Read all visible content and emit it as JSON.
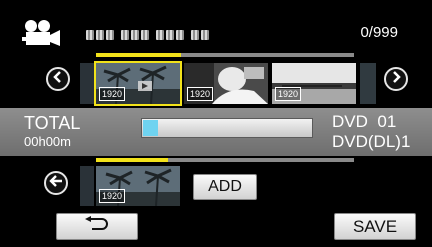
{
  "header": {
    "counter": "0/999",
    "camera_icon": "movie-camera-icon"
  },
  "timeline": {
    "progress_fraction": 0.33,
    "prev_icon": "chevron-left-circle-icon",
    "next_icon": "chevron-right-circle-icon",
    "thumbnails": [
      {
        "badge": "1920",
        "selected": true,
        "scene": "palm-trees"
      },
      {
        "badge": "1920",
        "selected": false,
        "scene": "person"
      },
      {
        "badge": "1920",
        "selected": false,
        "scene": "lake"
      },
      {
        "badge": "",
        "selected": false,
        "scene": "partial"
      }
    ]
  },
  "info_bar": {
    "total_label": "TOTAL",
    "total_time": "00h00m",
    "capacity_fraction": 0.09,
    "disc_type_label": "DVD",
    "disc_count_1": "01",
    "disc_type_2": "DVD(DL)1"
  },
  "selection": {
    "progress_fraction": 0.28,
    "back_icon": "arrow-left-circle-icon",
    "thumbnail_badge": "1920",
    "add_label": "ADD"
  },
  "footer": {
    "return_icon": "return-arrow-icon",
    "save_label": "SAVE"
  },
  "colors": {
    "background": "#000000",
    "progress_fill": "#f2e21a",
    "capacity_fill": "#6fd3f0",
    "info_bar": "#7e7e7e"
  }
}
